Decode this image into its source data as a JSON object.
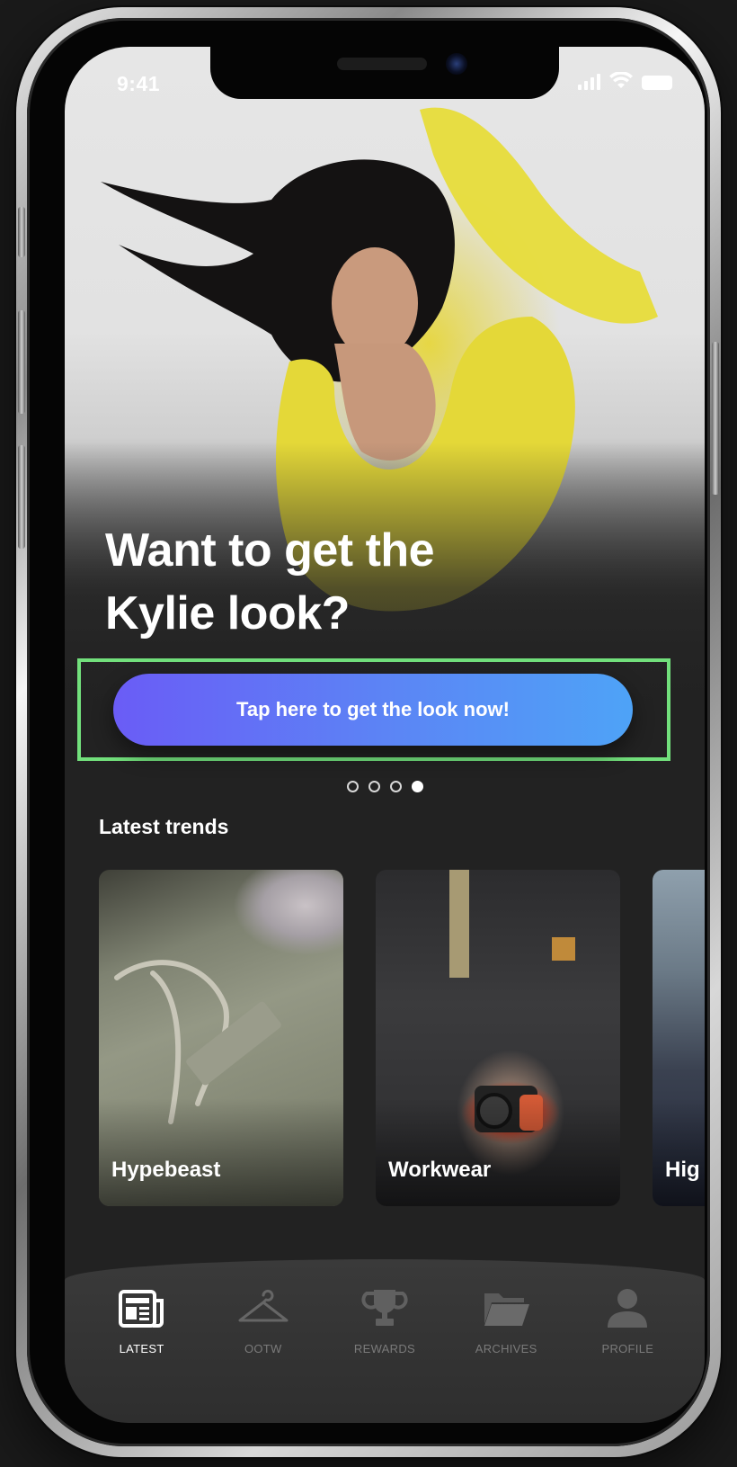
{
  "status_bar": {
    "time": "9:41"
  },
  "hero": {
    "headline_line1": "Want to get the",
    "headline_line2": "Kylie look?",
    "cta_label": "Tap here to get the look now!"
  },
  "pager": {
    "count": 4,
    "active_index": 3
  },
  "trends": {
    "title": "Latest trends",
    "cards": [
      {
        "label": "Hypebeast"
      },
      {
        "label": "Workwear"
      },
      {
        "label": "Hig"
      }
    ]
  },
  "bottom_nav": {
    "items": [
      {
        "label": "LATEST",
        "icon": "newspaper-icon",
        "active": true
      },
      {
        "label": "OOTW",
        "icon": "hanger-icon",
        "active": false
      },
      {
        "label": "REWARDS",
        "icon": "trophy-icon",
        "active": false
      },
      {
        "label": "ARCHIVES",
        "icon": "folder-icon",
        "active": false
      },
      {
        "label": "PROFILE",
        "icon": "person-icon",
        "active": false
      }
    ]
  },
  "colors": {
    "background": "#222222",
    "cta_gradient_start": "#6a5cf6",
    "cta_gradient_end": "#4ea3f7",
    "highlight_border": "#72e07c",
    "nav_active": "#ffffff",
    "nav_inactive": "#7a7a7a"
  }
}
